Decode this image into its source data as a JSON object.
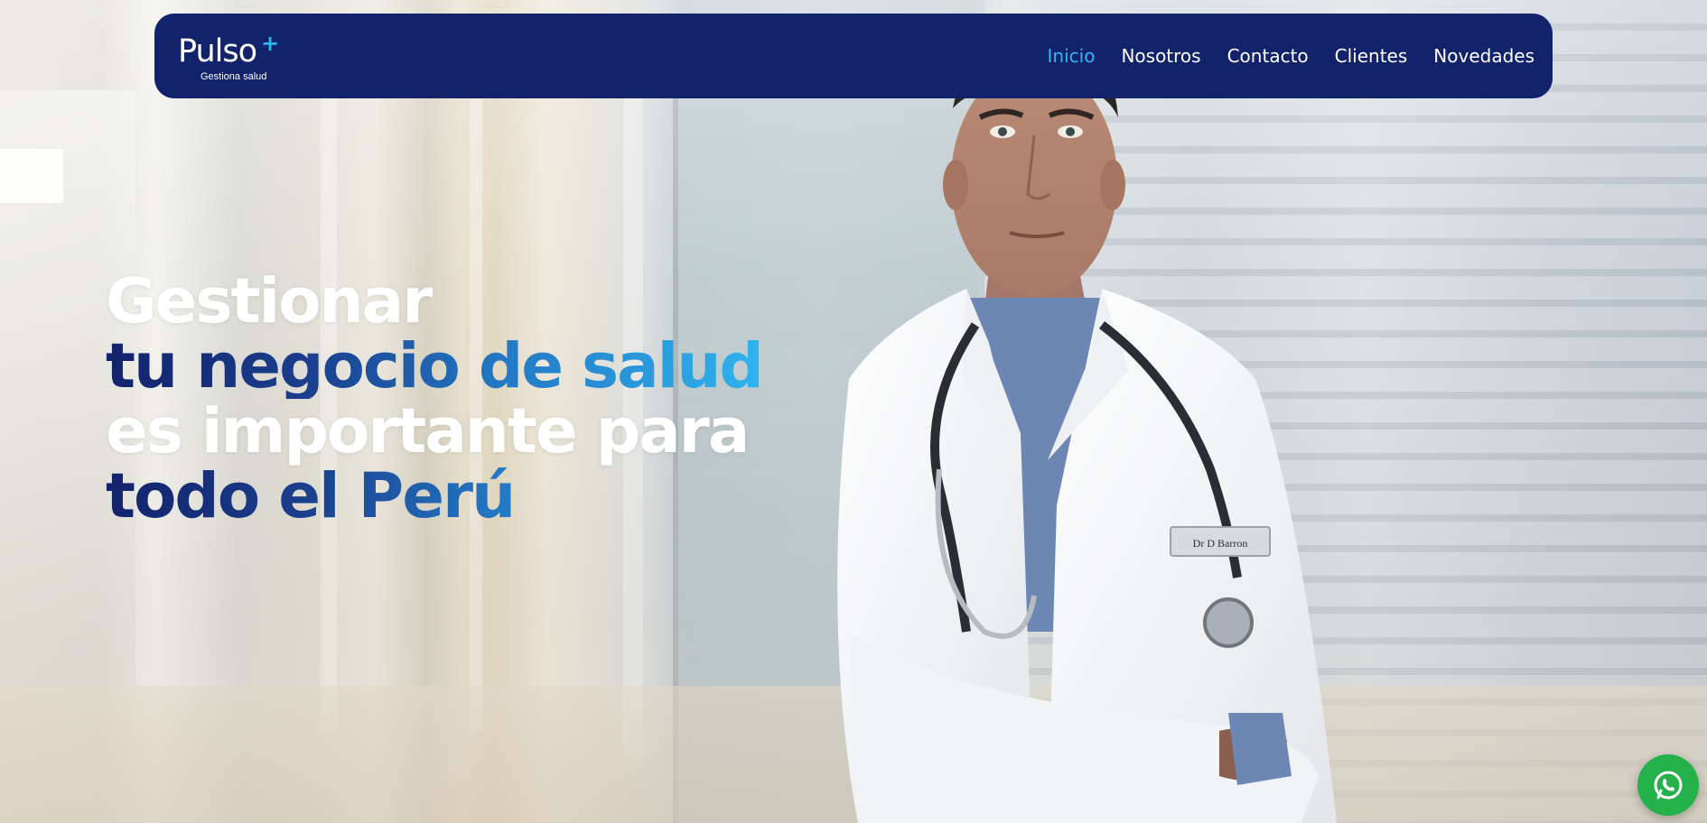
{
  "brand": {
    "name": "Pulso",
    "tagline": "Gestiona salud",
    "accent": "#2bb6f0",
    "navbar_color": "#12226b"
  },
  "nav": {
    "items": [
      {
        "label": "Inicio",
        "active": true
      },
      {
        "label": "Nosotros",
        "active": false
      },
      {
        "label": "Contacto",
        "active": false
      },
      {
        "label": "Clientes",
        "active": false
      },
      {
        "label": "Novedades",
        "active": false
      }
    ]
  },
  "hero": {
    "line1": "Gestionar",
    "line2": "tu negocio de salud",
    "line3": "es importante para",
    "line4": "todo el Perú",
    "gradient_colors": [
      "#13226b",
      "#2fb4ef"
    ]
  },
  "doctor": {
    "badge_text": "Dr D Barron"
  },
  "floating": {
    "whatsapp_icon": "whatsapp-icon",
    "whatsapp_color": "#25b14a"
  }
}
